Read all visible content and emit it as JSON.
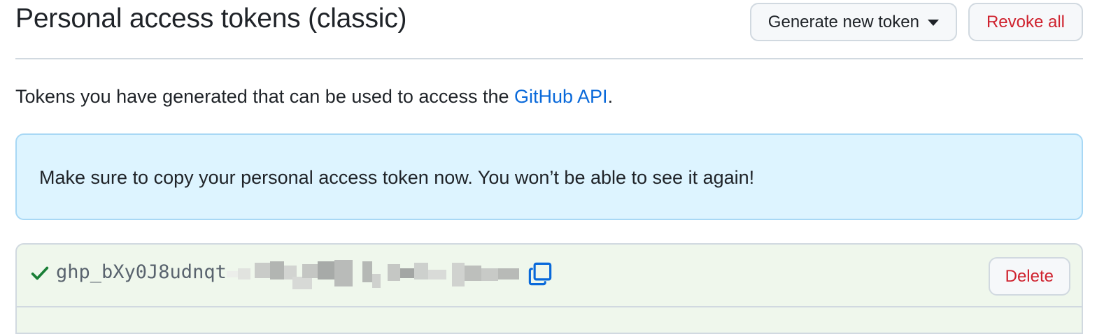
{
  "header": {
    "title": "Personal access tokens (classic)",
    "generate_label": "Generate new token",
    "revoke_all_label": "Revoke all"
  },
  "description": {
    "prefix": "Tokens you have generated that can be used to access the ",
    "link_text": "GitHub API",
    "suffix": "."
  },
  "flash": {
    "message": "Make sure to copy your personal access token now. You won’t be able to see it again!"
  },
  "token": {
    "visible_prefix": "ghp_bXy0J8udnqt",
    "delete_label": "Delete",
    "status_icon": "check-icon",
    "copy_icon": "copy-icon"
  },
  "colors": {
    "link": "#0969da",
    "danger": "#cf222e",
    "success": "#1a7f37",
    "info_background": "#ddf4ff",
    "token_background": "#eff7ec"
  }
}
